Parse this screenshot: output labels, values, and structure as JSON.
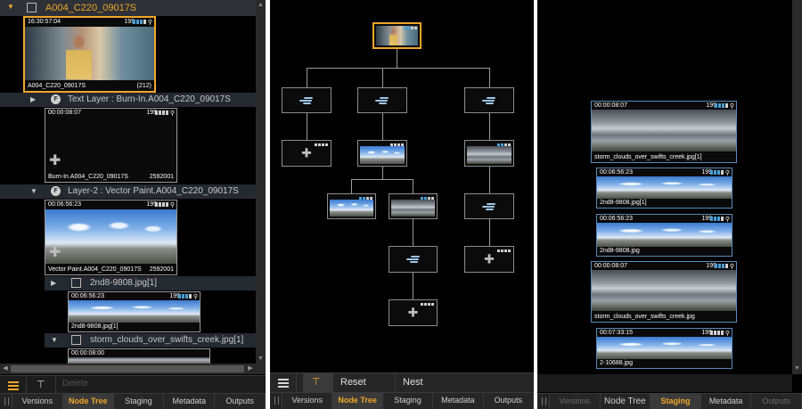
{
  "colors": {
    "accent": "#f0a628",
    "panel_bg": "#000000",
    "row_bg": "#252a31",
    "bar_blue": "#49a0d8"
  },
  "left_panel": {
    "tree": {
      "root": {
        "label": "A004_C220_09017S",
        "thumb": {
          "timecode": "16:30:57:04",
          "count": "199",
          "name": "A004_C220_09017S",
          "frames": "(212)"
        }
      },
      "text_layer": {
        "badge": "F",
        "label": "Text Layer : Burn-In.A004_C220_09017S",
        "thumb": {
          "timecode": "00:00:08:07",
          "count": "199",
          "name": "Burn-In.A004_C220_09017S",
          "frames": "2592001"
        }
      },
      "layer2": {
        "badge": "F",
        "label": "Layer-2 : Vector Paint.A004_C220_09017S",
        "thumb": {
          "timecode": "00:06:56:23",
          "count": "199",
          "name": "Vector Paint.A004_C220_09017S",
          "frames": "2592001"
        }
      },
      "item_2nd8": {
        "label": "2nd8-9808.jpg[1]",
        "thumb": {
          "timecode": "00:06:56:23",
          "count": "199",
          "name": "2nd8-9808.jpg[1]"
        }
      },
      "item_storm": {
        "label": "storm_clouds_over_swifts_creek.jpg[1]",
        "thumb": {
          "timecode": "00:00:08:00"
        }
      }
    },
    "toolbar": {
      "delete_label": "Delete"
    },
    "tabs": [
      "Versions",
      "Node Tree",
      "Staging",
      "Metadata",
      "Outputs"
    ],
    "active_tab": "Node Tree"
  },
  "middle_panel": {
    "toolbar": {
      "reset_label": "Reset",
      "nest_label": "Nest"
    },
    "tabs": [
      "Versions",
      "Node Tree",
      "Staging",
      "Metadata",
      "Outputs"
    ],
    "active_tab": "Node Tree"
  },
  "right_panel": {
    "staging": [
      {
        "timecode": "00:00:08:07",
        "count": "199",
        "name": "storm_clouds_over_swifts_creek.jpg[1]"
      },
      {
        "timecode": "00:06:56:23",
        "count": "199",
        "name": "2nd8-9808.jpg[1]"
      },
      {
        "timecode": "00:06:56:23",
        "count": "199",
        "name": "2nd8-9808.jpg"
      },
      {
        "timecode": "00:00:08:07",
        "count": "199",
        "name": "storm_clouds_over_swifts_creek.jpg"
      },
      {
        "timecode": "00:07:33:15",
        "count": "199",
        "name": "2-10688.jpg"
      }
    ],
    "tabs": [
      "Versions",
      "Node Tree",
      "Staging",
      "Metadata",
      "Outputs"
    ],
    "active_tab": "Staging"
  }
}
